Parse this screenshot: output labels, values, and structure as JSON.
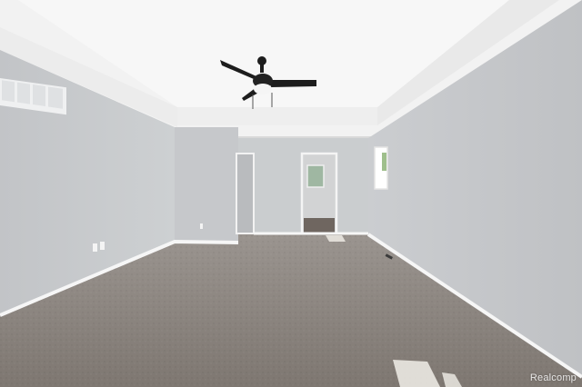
{
  "watermark": {
    "text": "Realcomp"
  },
  "colors": {
    "ceiling": "#f4f4f4",
    "ceiling_tray": "#fafafa",
    "wall_left": "#c7c9cb",
    "wall_right": "#c3c5c8",
    "wall_back": "#cdcfd1",
    "baseboard": "#f7f7f7",
    "carpet": "#8a837d",
    "fan": "#1d1d1d",
    "sunlight": "#f1efe9"
  },
  "icons": {
    "ceiling_fan": "ceiling-fan-icon",
    "vent": "air-vent-icon",
    "outlet": "wall-outlet-icon"
  }
}
